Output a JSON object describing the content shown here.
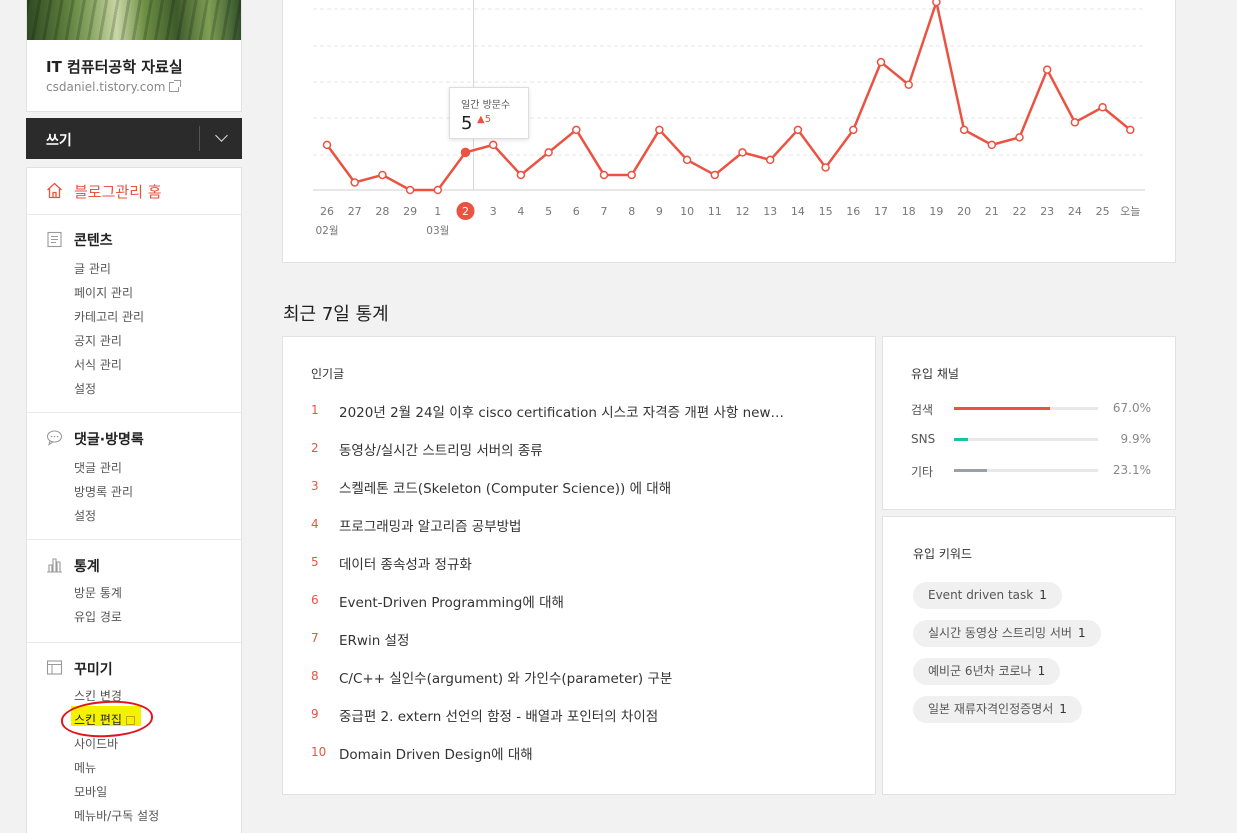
{
  "blog": {
    "title": "IT 컴퓨터공학 자료실",
    "url": "csdaniel.tistory.com"
  },
  "write": {
    "label": "쓰기"
  },
  "menu": {
    "home": "블로그관리 홈",
    "sections": [
      {
        "title": "콘텐츠",
        "items": [
          "글 관리",
          "페이지 관리",
          "카테고리 관리",
          "공지 관리",
          "서식 관리",
          "설정"
        ]
      },
      {
        "title": "댓글·방명록",
        "items": [
          "댓글 관리",
          "방명록 관리",
          "설정"
        ]
      },
      {
        "title": "통계",
        "items": [
          "방문 통계",
          "유입 경로"
        ]
      },
      {
        "title": "꾸미기",
        "items": [
          "스킨 변경",
          "스킨 편집",
          "사이드바",
          "메뉴",
          "모바일",
          "메뉴바/구독 설정"
        ]
      }
    ]
  },
  "chart_data": {
    "type": "line",
    "x": [
      "26",
      "27",
      "28",
      "29",
      "1",
      "2",
      "3",
      "4",
      "5",
      "6",
      "7",
      "8",
      "9",
      "10",
      "11",
      "12",
      "13",
      "14",
      "15",
      "16",
      "17",
      "18",
      "19",
      "20",
      "21",
      "22",
      "23",
      "24",
      "25",
      "오늘"
    ],
    "month_labels": [
      "02월",
      "03월"
    ],
    "values": [
      6,
      1,
      2,
      0,
      0,
      5,
      6,
      2,
      5,
      8,
      2,
      2,
      8,
      4,
      2,
      5,
      4,
      8,
      3,
      8,
      17,
      14,
      25,
      8,
      6,
      7,
      16,
      9,
      11,
      8
    ],
    "selected_index": 5,
    "tooltip": {
      "label": "일간 방문수",
      "value": "5",
      "delta": "5"
    },
    "colors": {
      "line": "#eb5242",
      "grid": "#e6e6e6"
    },
    "grid": true
  },
  "recent": {
    "title": "최근 7일 통계",
    "popular_title": "인기글",
    "popular": [
      {
        "rank": "1",
        "title": "2020년 2월 24일 이후 cisco certification 시스코 자격증 개편 사항 new…"
      },
      {
        "rank": "2",
        "title": "동영상/실시간 스트리밍 서버의 종류"
      },
      {
        "rank": "3",
        "title": "스켈레톤 코드(Skeleton (Computer Science)) 에 대해"
      },
      {
        "rank": "4",
        "title": "프로그래밍과 알고리즘 공부방법"
      },
      {
        "rank": "5",
        "title": "데이터 종속성과 정규화"
      },
      {
        "rank": "6",
        "title": "Event-Driven Programming에 대해"
      },
      {
        "rank": "7",
        "title": "ERwin 설정"
      },
      {
        "rank": "8",
        "title": "C/C++ 실인수(argument) 와 가인수(parameter) 구분"
      },
      {
        "rank": "9",
        "title": "중급편 2. extern 선언의 함정 - 배열과 포인터의 차이점"
      },
      {
        "rank": "10",
        "title": "Domain Driven Design에 대해"
      }
    ],
    "channel_title": "유입 채널",
    "channels": [
      {
        "label": "검색",
        "pct": "67.0%",
        "value": 67.0,
        "color": "#eb5242"
      },
      {
        "label": "SNS",
        "pct": "9.9%",
        "value": 9.9,
        "color": "#1ec0a0"
      },
      {
        "label": "기타",
        "pct": "23.1%",
        "value": 23.1,
        "color": "#9aa0a8"
      }
    ],
    "keyword_title": "유입 키워드",
    "keywords": [
      {
        "text": "Event driven task",
        "count": "1"
      },
      {
        "text": "실시간 동영상 스트리밍 서버",
        "count": "1"
      },
      {
        "text": "예비군 6년차 코로나",
        "count": "1"
      },
      {
        "text": "일본 재류자격인정증명서",
        "count": "1"
      }
    ]
  }
}
